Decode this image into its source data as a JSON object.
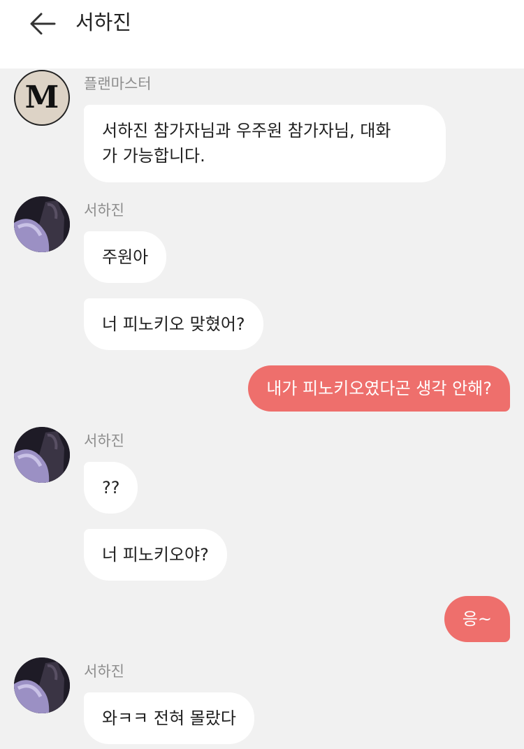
{
  "header": {
    "title": "서하진",
    "back_icon": "arrow-left-icon"
  },
  "colors": {
    "incoming_bubble": "#ffffff",
    "outgoing_bubble": "#ee6f6c",
    "background": "#f1f1f1"
  },
  "avatars": {
    "planmaster_letter": "M"
  },
  "messages": {
    "m1": {
      "sender": "플랜마스터",
      "text_line1": "서하진 참가자님과 우주원 참가자님, 대화",
      "text_line2": "가 가능합니다."
    },
    "m2": {
      "sender": "서하진",
      "text": "주원아"
    },
    "m3": {
      "text": "너 피노키오 맞혔어?"
    },
    "m4": {
      "text": "내가 피노키오였다곤 생각 안해?"
    },
    "m5": {
      "sender": "서하진",
      "text": "??"
    },
    "m6": {
      "text": "너 피노키오야?"
    },
    "m7": {
      "text": "응~"
    },
    "m8": {
      "sender": "서하진",
      "text": "와ㅋㅋ 전혀 몰랐다"
    }
  }
}
